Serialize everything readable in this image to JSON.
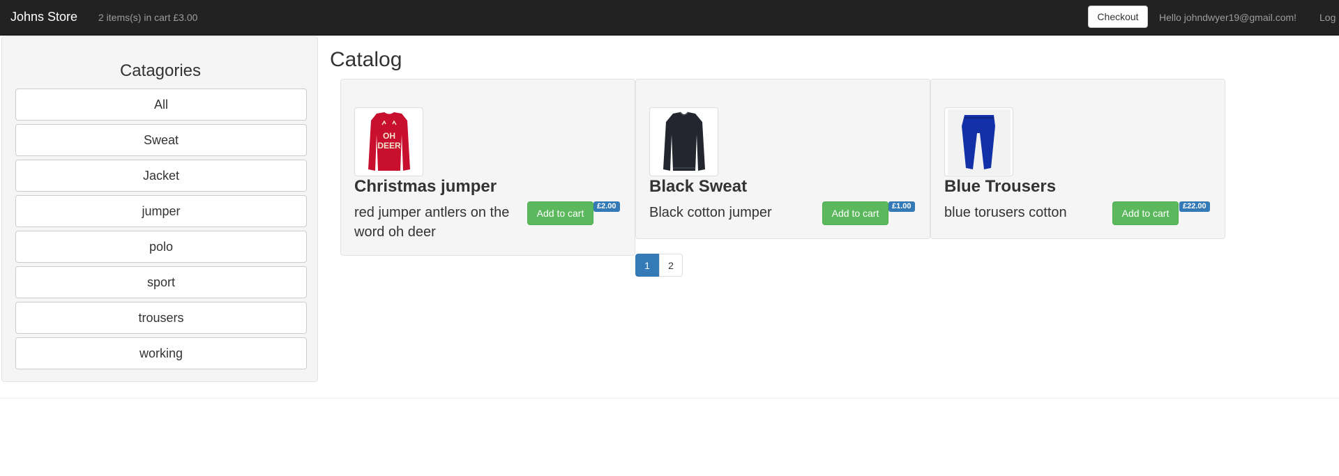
{
  "navbar": {
    "brand": "Johns Store",
    "cart_summary": "2 items(s) in cart £3.00",
    "checkout_label": "Checkout",
    "greeting": "Hello johndwyer19@gmail.com!",
    "logout_label": "Log"
  },
  "sidebar": {
    "title": "Catagories",
    "categories": [
      "All",
      "Sweat",
      "Jacket",
      "jumper",
      "polo",
      "sport",
      "trousers",
      "working"
    ]
  },
  "catalog": {
    "title": "Catalog",
    "products": [
      {
        "name": "Christmas jumper",
        "description": "red jumper antlers on the word oh deer",
        "add_label": "Add to cart",
        "price": "£2.00",
        "image_icon": "red-jumper-icon"
      },
      {
        "name": "Black Sweat",
        "description": "Black cotton jumper",
        "add_label": "Add to cart",
        "price": "£1.00",
        "image_icon": "black-sweater-icon"
      },
      {
        "name": "Blue Trousers",
        "description": "blue torusers cotton",
        "add_label": "Add to cart",
        "price": "£22.00",
        "image_icon": "blue-trousers-icon"
      }
    ]
  },
  "pagination": {
    "pages": [
      "1",
      "2"
    ],
    "active": "1"
  },
  "colors": {
    "navbar_bg": "#222222",
    "success": "#5cb85c",
    "primary": "#337ab7",
    "well_bg": "#f5f5f5"
  }
}
